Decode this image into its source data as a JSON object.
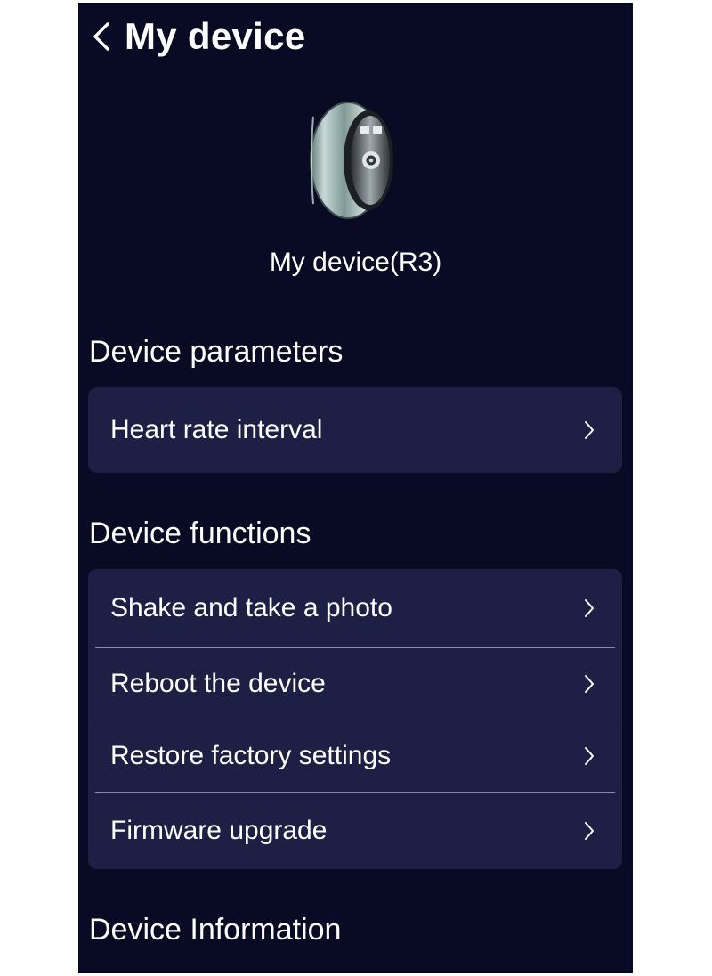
{
  "header": {
    "title": "My device",
    "back_icon": "chevron-left-icon"
  },
  "device": {
    "image": "smart-ring-image",
    "name": "My device(R3)"
  },
  "sections": {
    "parameters": {
      "title": "Device parameters",
      "items": [
        {
          "label": "Heart rate interval",
          "icon": "chevron-right-icon"
        }
      ]
    },
    "functions": {
      "title": "Device functions",
      "items": [
        {
          "label": "Shake and take a photo",
          "icon": "chevron-right-icon"
        },
        {
          "label": "Reboot the device",
          "icon": "chevron-right-icon"
        },
        {
          "label": "Restore factory settings",
          "icon": "chevron-right-icon"
        },
        {
          "label": "Firmware upgrade",
          "icon": "chevron-right-icon"
        }
      ]
    },
    "information": {
      "title": "Device Information"
    }
  },
  "colors": {
    "background": "#090b24",
    "card": "#1d1f44",
    "text": "#ffffff",
    "divider": "#8a8ca6"
  }
}
